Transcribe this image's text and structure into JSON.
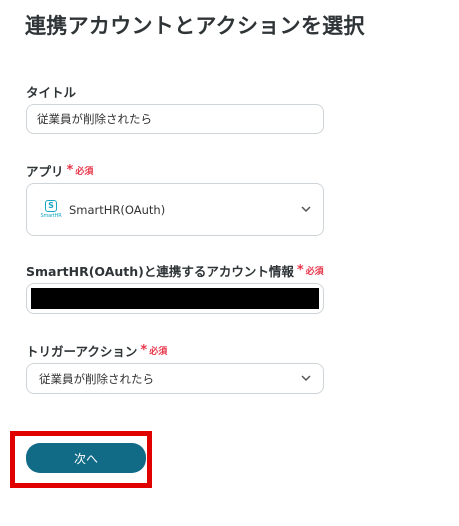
{
  "page_title": "連携アカウントとアクションを選択",
  "required_label": "必須",
  "title_field": {
    "label": "タイトル",
    "value": "従業員が削除されたら"
  },
  "app_field": {
    "label": "アプリ",
    "value": "SmartHR(OAuth)",
    "app_icon": "smarthr-logo",
    "logo_letter": "S",
    "logo_word": "SmartHR"
  },
  "account_field": {
    "label": "SmartHR(OAuth)と連携するアカウント情報"
  },
  "trigger_field": {
    "label": "トリガーアクション",
    "value": "従業員が削除されたら"
  },
  "next_button": {
    "label": "次へ"
  },
  "colors": {
    "accent": "#116b87",
    "required": "#e8364a",
    "highlight_border": "#e10000"
  }
}
